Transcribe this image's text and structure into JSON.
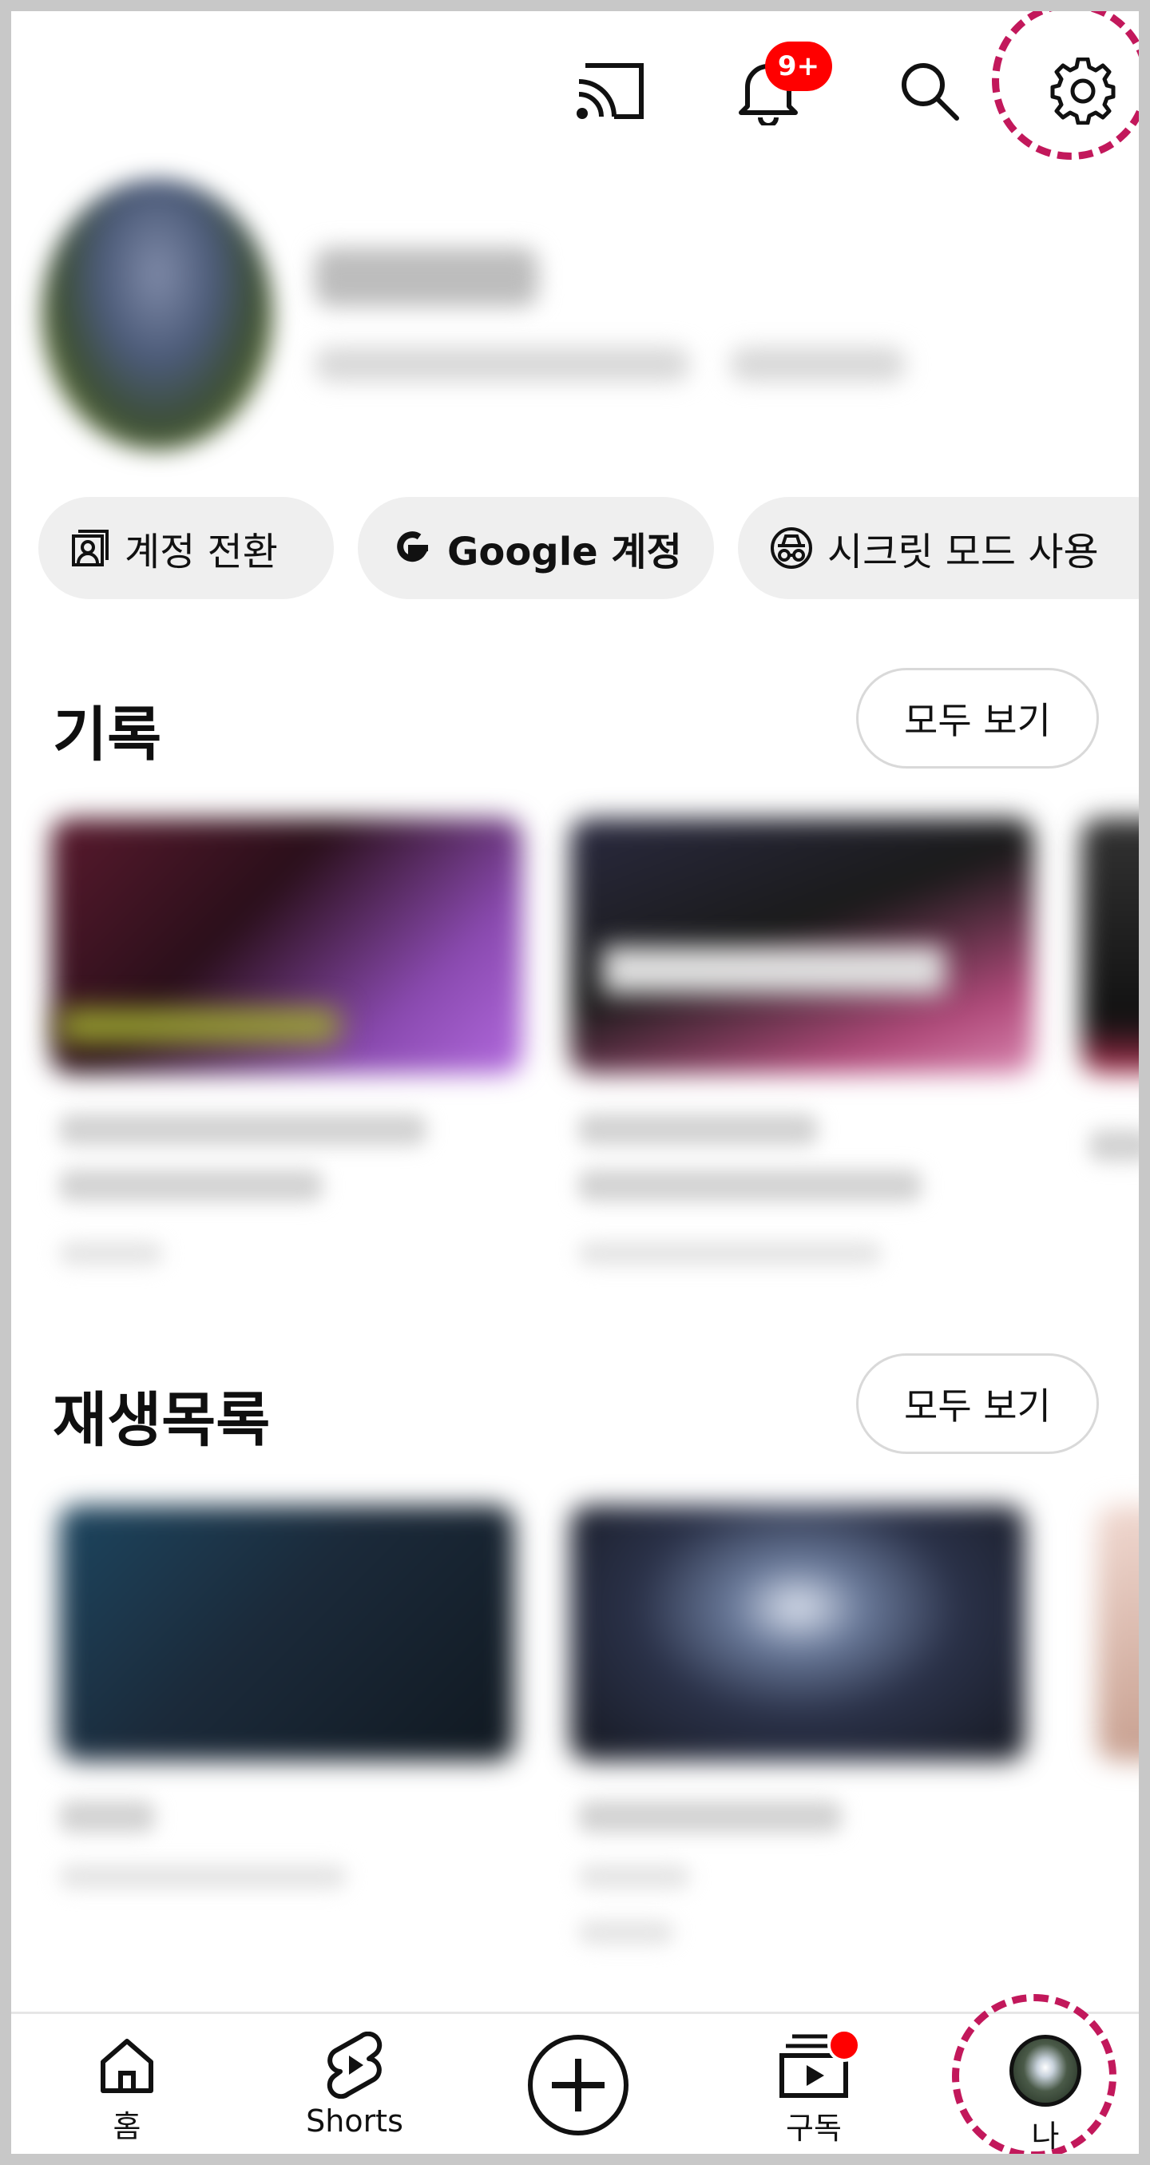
{
  "header": {
    "icons": [
      "cast-icon",
      "bell-icon",
      "search-icon",
      "gear-icon"
    ],
    "notification_badge": "9+"
  },
  "chips": [
    {
      "label": "계정 전환",
      "icon": "switch-account-icon"
    },
    {
      "label": "Google 계정",
      "icon": "google-g-icon"
    },
    {
      "label": "시크릿 모드 사용",
      "icon": "incognito-icon"
    }
  ],
  "sections": {
    "history": {
      "title": "기록",
      "see_all": "모두 보기"
    },
    "playlists": {
      "title": "재생목록",
      "see_all": "모두 보기"
    }
  },
  "bottom_nav": {
    "items": [
      {
        "label": "홈",
        "icon": "home-icon"
      },
      {
        "label": "Shorts",
        "icon": "shorts-icon"
      },
      {
        "label": "",
        "icon": "create-plus-icon"
      },
      {
        "label": "구독",
        "icon": "subscriptions-icon"
      },
      {
        "label": "나",
        "icon": "profile-avatar"
      }
    ]
  },
  "colors": {
    "badge": "#ff0000",
    "highlight": "#c2185b",
    "chip_bg": "#efefef"
  }
}
